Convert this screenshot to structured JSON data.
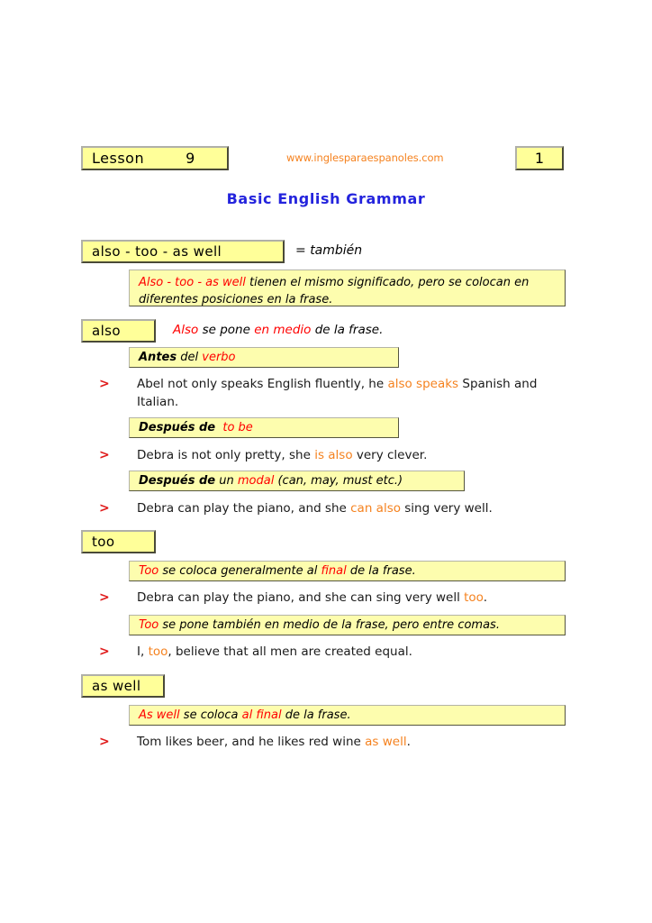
{
  "header": {
    "lesson_label": "Lesson",
    "lesson_number": "9",
    "site_url": "www.inglesparaespanoles.com",
    "page_number": "1",
    "title": "Basic English Grammar"
  },
  "topic": {
    "headword": "also  -  too  -  as well",
    "equals_sign": "=",
    "translation": "también",
    "intro_note": {
      "terms": "Also  -  too  -  as well",
      "rest": "tienen el mismo significado, pero se colocan en diferentes posiciones en la frase."
    }
  },
  "sections": [
    {
      "headword": "also",
      "inline_rule": {
        "word": "Also",
        "mid": "se pone",
        "emphasis": "en medio",
        "end": "de la frase."
      },
      "rules": [
        {
          "id": "antes-del-verbo",
          "lead": "Antes",
          "mid": "del",
          "emphasis": "verbo",
          "tail": ""
        },
        {
          "id": "despues-de-to-be",
          "lead": "Después de",
          "mid": "",
          "emphasis": "to be",
          "tail": ""
        },
        {
          "id": "despues-de-un-modal",
          "lead": "Después de",
          "mid": "un",
          "emphasis": "modal",
          "tail": "(can, may, must etc.)"
        }
      ],
      "examples": [
        {
          "marker": ">",
          "pre": "Abel not only speaks English fluently, he ",
          "highlight": "also speaks",
          "post": " Spanish and Italian."
        },
        {
          "marker": ">",
          "pre": "Debra is not only pretty, she ",
          "highlight": "is also",
          "post": " very clever."
        },
        {
          "marker": ">",
          "pre": "Debra can play the piano, and she ",
          "highlight": "can also",
          "post": " sing very well."
        }
      ]
    },
    {
      "headword": "too",
      "rules": [
        {
          "id": "too-final",
          "lead": "Too",
          "mid": "se coloca generalmente al",
          "emphasis": "final",
          "tail": "de la frase."
        },
        {
          "id": "too-comas",
          "lead": "Too",
          "mid": "se pone también en medio de la frase, pero entre comas.",
          "emphasis": "",
          "tail": ""
        }
      ],
      "examples": [
        {
          "marker": ">",
          "pre": "Debra can play the piano, and she can sing very well ",
          "highlight": "too",
          "post": "."
        },
        {
          "marker": ">",
          "pre": "I, ",
          "highlight": "too",
          "post": ", believe that all men are created equal."
        }
      ]
    },
    {
      "headword": "as well",
      "rules": [
        {
          "id": "aswell-final",
          "lead": "As well",
          "mid": "se coloca",
          "emphasis": "al final",
          "tail": "de la frase."
        }
      ],
      "examples": [
        {
          "marker": ">",
          "pre": "Tom likes beer, and he likes red wine ",
          "highlight": "as well",
          "post": "."
        }
      ]
    }
  ],
  "colors": {
    "box_fill": "#FFFF99",
    "note_fill": "#FDFDAE",
    "title_blue": "#2424DD",
    "url_orange": "#F5821F",
    "highlight_orange": "#F5821F",
    "rule_red": "#FF0000",
    "marker_red": "#E01B1B"
  }
}
